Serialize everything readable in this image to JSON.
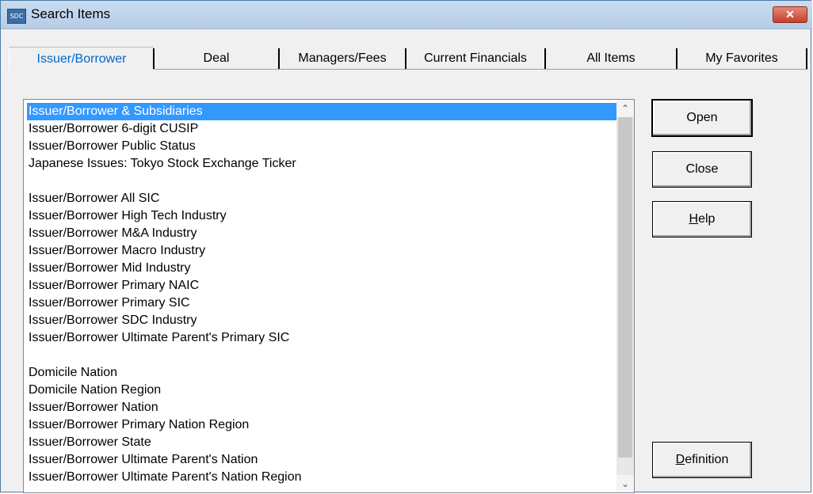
{
  "window": {
    "title": "Search Items",
    "app_icon_text": "SDC",
    "close_symbol": "✕"
  },
  "tabs": [
    {
      "label": "Issuer/Borrower",
      "active": true
    },
    {
      "label": "Deal",
      "active": false
    },
    {
      "label": "Managers/Fees",
      "active": false
    },
    {
      "label": "Current Financials",
      "active": false
    },
    {
      "label": "All Items",
      "active": false
    },
    {
      "label": "My Favorites",
      "active": false
    }
  ],
  "list": {
    "items": [
      {
        "text": "Issuer/Borrower & Subsidiaries",
        "selected": true
      },
      {
        "text": "Issuer/Borrower 6-digit CUSIP"
      },
      {
        "text": "Issuer/Borrower Public Status"
      },
      {
        "text": "Japanese Issues: Tokyo Stock Exchange Ticker"
      },
      {
        "text": ""
      },
      {
        "text": "Issuer/Borrower All SIC"
      },
      {
        "text": "Issuer/Borrower High Tech Industry"
      },
      {
        "text": "Issuer/Borrower M&A Industry"
      },
      {
        "text": "Issuer/Borrower Macro Industry"
      },
      {
        "text": "Issuer/Borrower Mid Industry"
      },
      {
        "text": "Issuer/Borrower Primary NAIC"
      },
      {
        "text": "Issuer/Borrower Primary SIC"
      },
      {
        "text": "Issuer/Borrower SDC Industry"
      },
      {
        "text": "Issuer/Borrower Ultimate Parent's Primary SIC"
      },
      {
        "text": ""
      },
      {
        "text": "Domicile Nation"
      },
      {
        "text": "Domicile Nation Region"
      },
      {
        "text": "Issuer/Borrower Nation"
      },
      {
        "text": "Issuer/Borrower Primary Nation Region"
      },
      {
        "text": "Issuer/Borrower State"
      },
      {
        "text": "Issuer/Borrower Ultimate Parent's Nation"
      },
      {
        "text": "Issuer/Borrower Ultimate Parent's Nation Region"
      }
    ],
    "scroll_up_symbol": "⌃",
    "scroll_down_symbol": "⌄"
  },
  "buttons": {
    "open": "Open",
    "close": "Close",
    "help_accel": "H",
    "help_rest": "elp",
    "definition_accel": "D",
    "definition_rest": "efinition"
  }
}
